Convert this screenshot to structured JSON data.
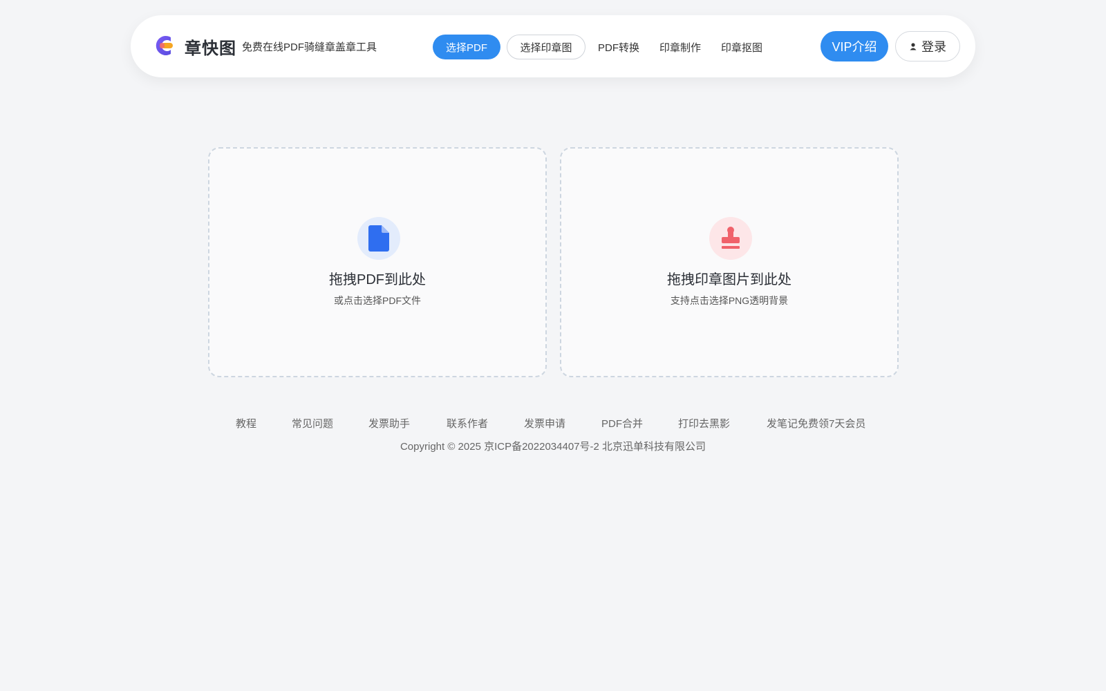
{
  "header": {
    "brand_name": "章快图",
    "brand_subtitle": "免费在线PDF骑缝章盖章工具",
    "nav": {
      "select_pdf": "选择PDF",
      "select_stamp": "选择印章图",
      "pdf_convert": "PDF转换",
      "stamp_make": "印章制作",
      "stamp_cutout": "印章抠图"
    },
    "vip_label": "VIP介绍",
    "login_label": "登录"
  },
  "upload": {
    "pdf": {
      "icon": "pdf-file-icon",
      "title": "拖拽PDF到此处",
      "subtitle": "或点击选择PDF文件"
    },
    "stamp": {
      "icon": "stamp-icon",
      "title": "拖拽印章图片到此处",
      "subtitle": "支持点击选择PNG透明背景"
    }
  },
  "footer": {
    "links": [
      "教程",
      "常见问题",
      "发票助手",
      "联系作者",
      "发票申请",
      "PDF合并",
      "打印去黑影",
      "发笔记免费领7天会员"
    ],
    "copyright": "Copyright © 2025 京ICP备2022034407号-2 北京迅单科技有限公司"
  },
  "colors": {
    "primary": "#2f8cf0",
    "background": "#f4f5f7",
    "pdf_icon": "#2f6ef0",
    "stamp_icon": "#f0626b"
  }
}
